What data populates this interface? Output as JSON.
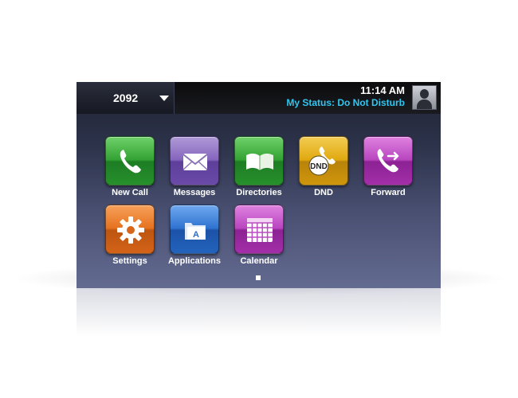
{
  "header": {
    "line_number": "2092",
    "time": "11:14 AM",
    "status": "My Status: Do Not Disturb"
  },
  "apps": [
    {
      "label": "New Call",
      "icon": "phone-handset-icon",
      "color": "#33a233"
    },
    {
      "label": "Messages",
      "icon": "envelope-icon",
      "color": "#8565bd"
    },
    {
      "label": "Directories",
      "icon": "open-book-icon",
      "color": "#33a233"
    },
    {
      "label": "DND",
      "icon": "dnd-phone-icon",
      "color": "#e1a90f"
    },
    {
      "label": "Forward",
      "icon": "forward-call-icon",
      "color": "#b945bf"
    },
    {
      "label": "Settings",
      "icon": "gear-icon",
      "color": "#e6721f"
    },
    {
      "label": "Applications",
      "icon": "applications-icon",
      "color": "#2f73d0"
    },
    {
      "label": "Calendar",
      "icon": "calendar-icon",
      "color": "#b945bf"
    }
  ],
  "dnd_badge": "DND",
  "applications_badge": "A",
  "pagination": {
    "current_page": 1,
    "total_pages": 1
  }
}
